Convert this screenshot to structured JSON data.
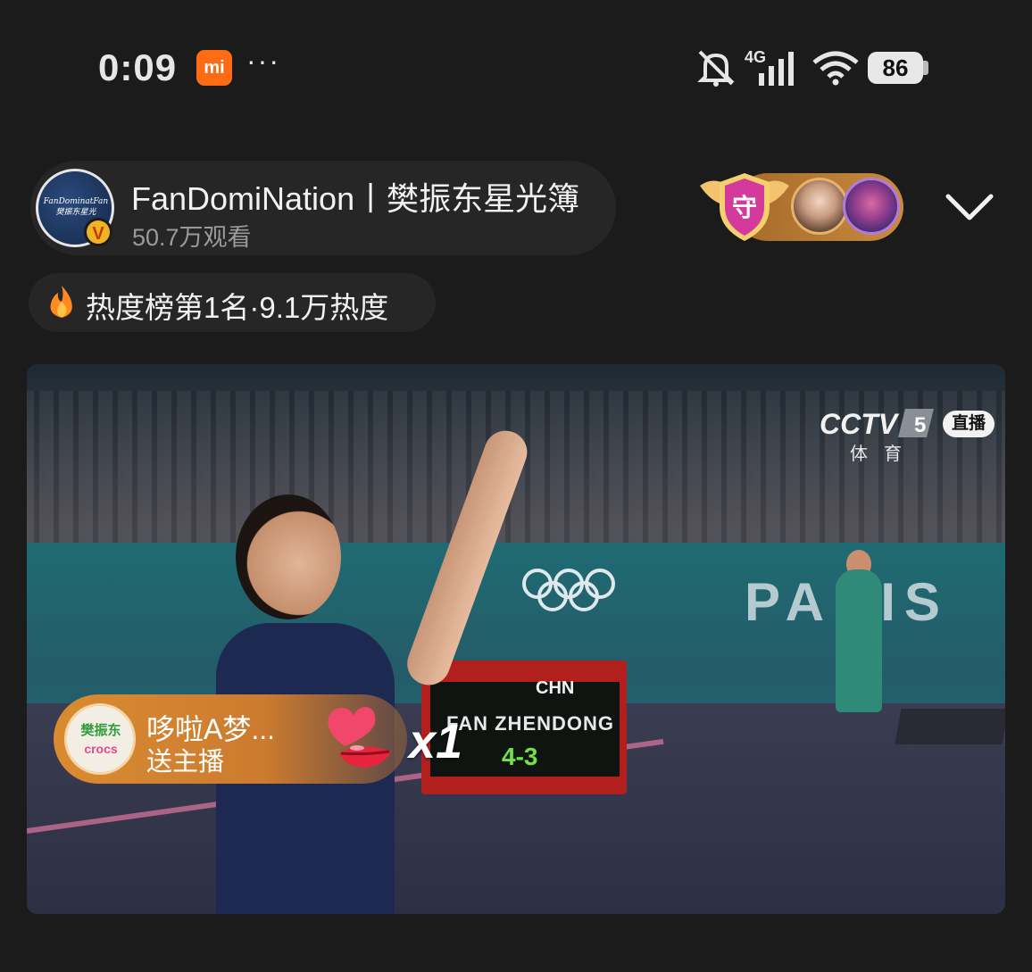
{
  "status_bar": {
    "time": "0:09",
    "mi_label": "mi",
    "more": "···",
    "network": "4G",
    "battery": "86",
    "icons": [
      "mute-icon",
      "signal-icon",
      "wifi-icon",
      "battery-icon"
    ]
  },
  "header": {
    "avatar_text": "FanDominatFan 樊振东星光",
    "channel_name": "FanDomiNation丨樊振东星光簿",
    "viewers": "50.7万观看",
    "guard_badge": "守",
    "collapse_icon": "chevron-down-icon"
  },
  "heat": {
    "text": "热度榜第1名·9.1万热度"
  },
  "video": {
    "broadcaster": "CCTV",
    "channel_number": "5",
    "live_tag": "直播",
    "sports_label": "体育",
    "venue_text": "PARIS",
    "scoreboard": {
      "country": "CHN",
      "player": "FAN ZHENDONG",
      "score": "4-3"
    }
  },
  "gift_notice": {
    "avatar_top": "樊振东",
    "avatar_bottom": "crocs",
    "sender": "哆啦A梦...",
    "action": "送主播",
    "count": "x1",
    "gift_icon": "heart-kiss-icon"
  },
  "colors": {
    "background": "#1b1b1b",
    "accent_orange": "#ff6a14",
    "gift_banner": "#d98b30"
  }
}
